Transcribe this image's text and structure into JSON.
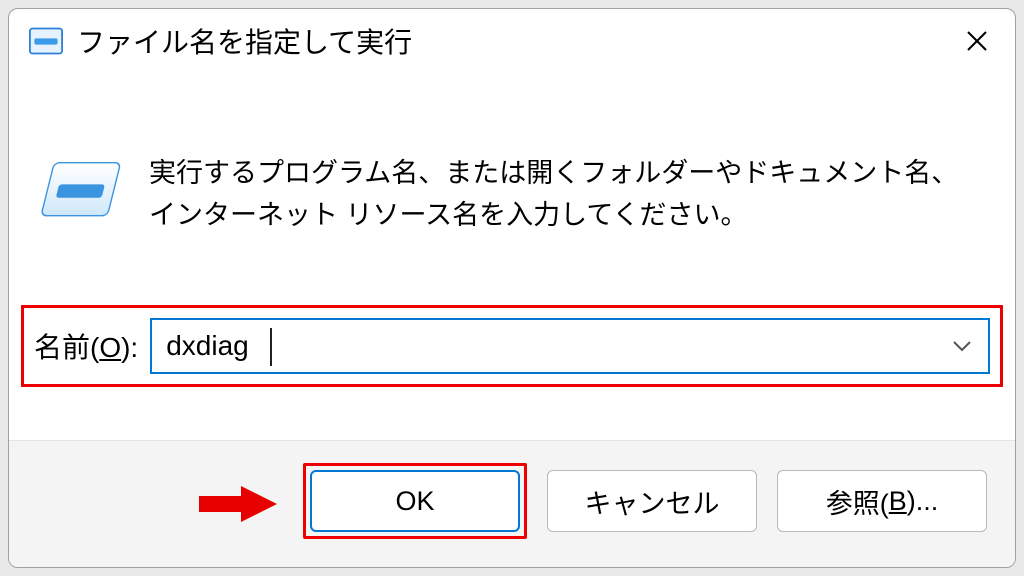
{
  "dialog": {
    "title": "ファイル名を指定して実行",
    "instruction": "実行するプログラム名、または開くフォルダーやドキュメント名、インターネット リソース名を入力してください。"
  },
  "input": {
    "label_prefix": "名前(",
    "label_accel": "O",
    "label_suffix": "):",
    "value": "dxdiag"
  },
  "buttons": {
    "ok": "OK",
    "cancel": "キャンセル",
    "browse_prefix": "参照(",
    "browse_accel": "B",
    "browse_suffix": ")..."
  }
}
